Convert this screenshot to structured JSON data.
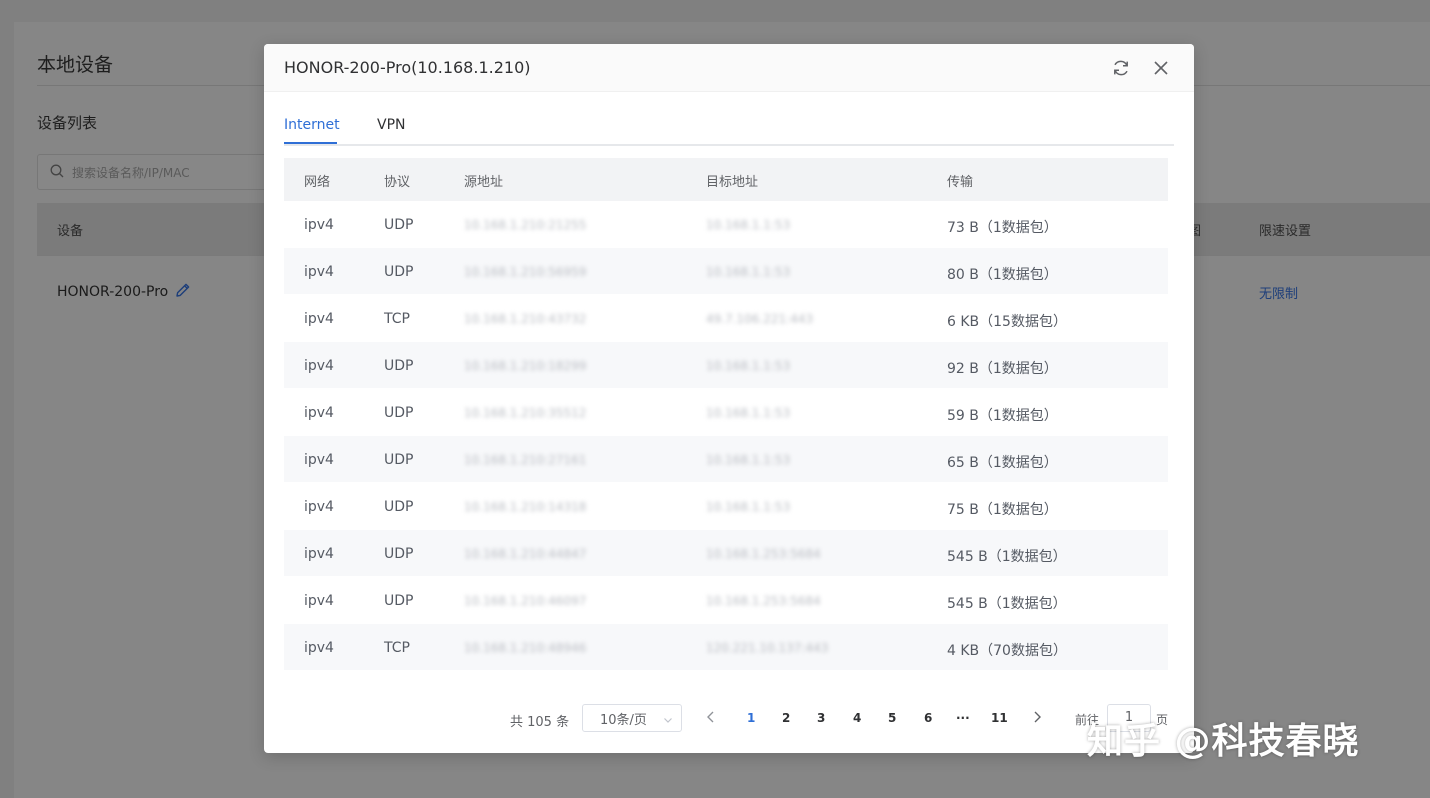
{
  "background": {
    "title": "本地设备",
    "subtitle": "设备列表",
    "search_placeholder": "搜索设备名称/IP/MAC",
    "columns": {
      "device": "设备",
      "partial": "图",
      "limit": "限速设置"
    },
    "device_name": "HONOR-200-Pro",
    "limit_value": "无限制"
  },
  "modal": {
    "title": "HONOR-200-Pro(10.168.1.210)",
    "tabs": [
      {
        "label": "Internet",
        "active": true
      },
      {
        "label": "VPN",
        "active": false
      }
    ],
    "columns": [
      "网络",
      "协议",
      "源地址",
      "目标地址",
      "传输"
    ],
    "rows": [
      {
        "network": "ipv4",
        "protocol": "UDP",
        "source": "10.168.1.210:21255",
        "target": "10.168.1.1:53",
        "transfer": "73 B（1数据包）"
      },
      {
        "network": "ipv4",
        "protocol": "UDP",
        "source": "10.168.1.210:56959",
        "target": "10.168.1.1:53",
        "transfer": "80 B（1数据包）"
      },
      {
        "network": "ipv4",
        "protocol": "TCP",
        "source": "10.168.1.210:43732",
        "target": "49.7.106.221:443",
        "transfer": "6 KB（15数据包）"
      },
      {
        "network": "ipv4",
        "protocol": "UDP",
        "source": "10.168.1.210:18299",
        "target": "10.168.1.1:53",
        "transfer": "92 B（1数据包）"
      },
      {
        "network": "ipv4",
        "protocol": "UDP",
        "source": "10.168.1.210:35512",
        "target": "10.168.1.1:53",
        "transfer": "59 B（1数据包）"
      },
      {
        "network": "ipv4",
        "protocol": "UDP",
        "source": "10.168.1.210:27161",
        "target": "10.168.1.1:53",
        "transfer": "65 B（1数据包）"
      },
      {
        "network": "ipv4",
        "protocol": "UDP",
        "source": "10.168.1.210:14318",
        "target": "10.168.1.1:53",
        "transfer": "75 B（1数据包）"
      },
      {
        "network": "ipv4",
        "protocol": "UDP",
        "source": "10.168.1.210:44847",
        "target": "10.168.1.253:5684",
        "transfer": "545 B（1数据包）"
      },
      {
        "network": "ipv4",
        "protocol": "UDP",
        "source": "10.168.1.210:46097",
        "target": "10.168.1.253:5684",
        "transfer": "545 B（1数据包）"
      },
      {
        "network": "ipv4",
        "protocol": "TCP",
        "source": "10.168.1.210:48946",
        "target": "120.221.10.137:443",
        "transfer": "4 KB（70数据包）"
      }
    ],
    "pagination": {
      "total": "共 105 条",
      "page_size": "10条/页",
      "pages": [
        "1",
        "2",
        "3",
        "4",
        "5",
        "6",
        "···",
        "11"
      ],
      "current": "1",
      "jump_label": "前往",
      "jump_value": "1",
      "jump_suffix": "页"
    }
  },
  "watermark": "知乎 @科技春晓",
  "colors": {
    "accent": "#2f6fd6",
    "overlay": "#808080",
    "header_bg": "#f2f3f5"
  }
}
